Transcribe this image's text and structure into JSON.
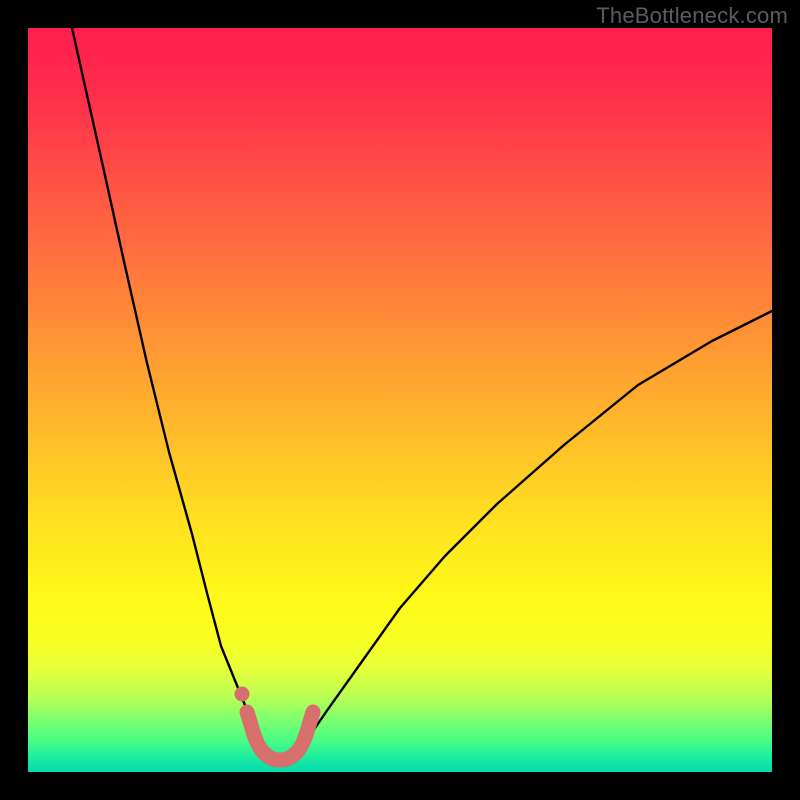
{
  "watermark": "TheBottleneck.com",
  "colors": {
    "frame": "#000000",
    "curve_stroke": "#000000",
    "marker_stroke": "#d76f6c",
    "gradient_stops": [
      "#ff1f4e",
      "#ff2b4d",
      "#ff4a47",
      "#ff6f3f",
      "#ff9535",
      "#ffba2b",
      "#ffe020",
      "#fff81a",
      "#f9ff20",
      "#e8ff3a",
      "#b8ff55",
      "#7cff6e",
      "#46fc87",
      "#1bed9f",
      "#06d8af"
    ]
  },
  "chart_data": {
    "type": "line",
    "title": "",
    "xlabel": "",
    "ylabel": "",
    "xlim": [
      0,
      100
    ],
    "ylim": [
      0,
      100
    ],
    "grid": false,
    "legend": false,
    "series": [
      {
        "name": "bottleneck-curve",
        "x": [
          6,
          10,
          13,
          16,
          19,
          22,
          24,
          26,
          28,
          30,
          31,
          32,
          33,
          34,
          35,
          36.5,
          40,
          45,
          50,
          56,
          63,
          72,
          82,
          92,
          100
        ],
        "values": [
          100,
          82,
          68,
          55,
          43,
          32,
          24,
          17,
          12,
          7,
          5,
          3,
          1.8,
          1.4,
          1.8,
          3,
          8,
          15,
          22,
          29,
          36,
          44,
          52,
          58,
          62
        ]
      }
    ],
    "markers": {
      "name": "optimal-range-marker",
      "color": "#d76f6c",
      "x_range": [
        29.5,
        36
      ],
      "y": 2,
      "note": "U-shaped highlighted band at curve minimum"
    }
  }
}
